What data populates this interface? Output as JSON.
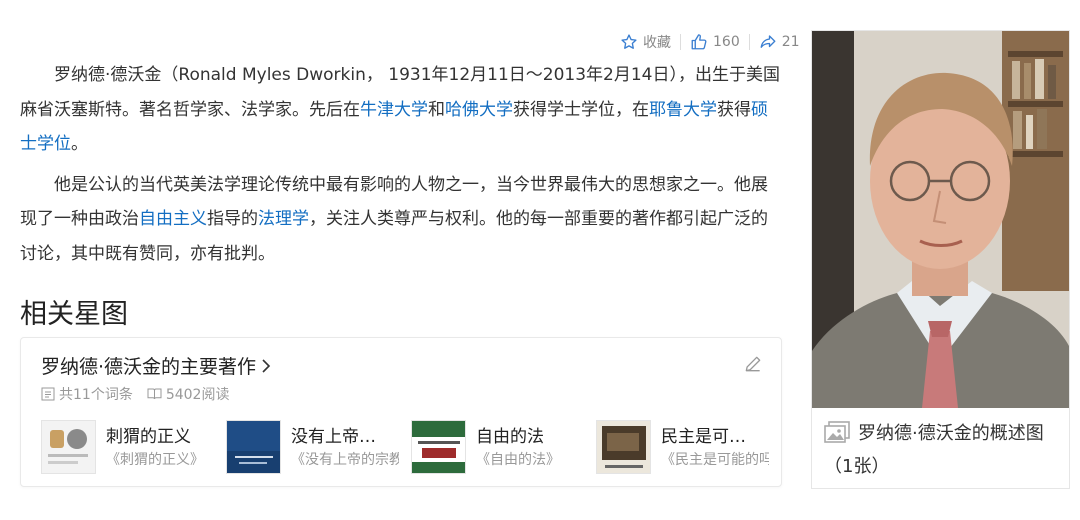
{
  "actions": {
    "favorite_label": "收藏",
    "like_count": "160",
    "share_count": "21"
  },
  "article": {
    "p1": {
      "t1": "罗纳德·德沃金（Ronald Myles Dworkin， 1931年12月11日～2013年2月14日），出生于美国麻省沃塞斯特。著名哲学家、法学家。先后在",
      "link1": "牛津大学",
      "t2": "和",
      "link2": "哈佛大学",
      "t3": "获得学士学位，在",
      "link3": "耶鲁大学",
      "t4": "获得",
      "link4": "硕士学位",
      "t5": "。"
    },
    "p2": {
      "t1": "他是公认的当代英美法学理论传统中最有影响的人物之一，当今世界最伟大的思想家之一。他展现了一种由政治",
      "link1": "自由主义",
      "t2": "指导的",
      "link2": "法理学",
      "t3": "，关注人类尊严与权利。他的每一部重要的著作都引起广泛的讨论，其中既有赞同，亦有批判。"
    }
  },
  "related": {
    "section_title": "相关星图",
    "card_title": "罗纳德·德沃金的主要著作",
    "term_count": "共11个词条",
    "read_count": "5402阅读",
    "books": [
      {
        "title": "刺猬的正义",
        "subtitle": "《刺猬的正义》"
      },
      {
        "title": "没有上帝…",
        "subtitle": "《没有上帝的宗教》"
      },
      {
        "title": "自由的法",
        "subtitle": "《自由的法》"
      },
      {
        "title": "民主是可…",
        "subtitle": "《民主是可能的吗》"
      }
    ]
  },
  "sidebar": {
    "caption": "罗纳德·德沃金的概述图（1张）"
  },
  "colors": {
    "link": "#136ec2",
    "text": "#333333",
    "muted": "#999999",
    "icon": "#3b7fd1"
  }
}
